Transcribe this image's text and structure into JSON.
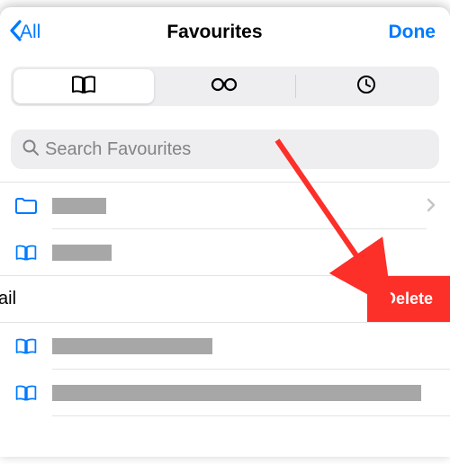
{
  "nav": {
    "back_label": "All",
    "title": "Favourites",
    "done_label": "Done"
  },
  "segments": {
    "bookmarks_selected": true
  },
  "search": {
    "placeholder": "Search Favourites"
  },
  "rows": {
    "swiped_tail_text": "ail",
    "delete_label": "Delete"
  },
  "colors": {
    "accent": "#007aff",
    "destructive": "#fc2f29",
    "search_bg": "#eeeef0",
    "redact": "#a7a7a7"
  }
}
